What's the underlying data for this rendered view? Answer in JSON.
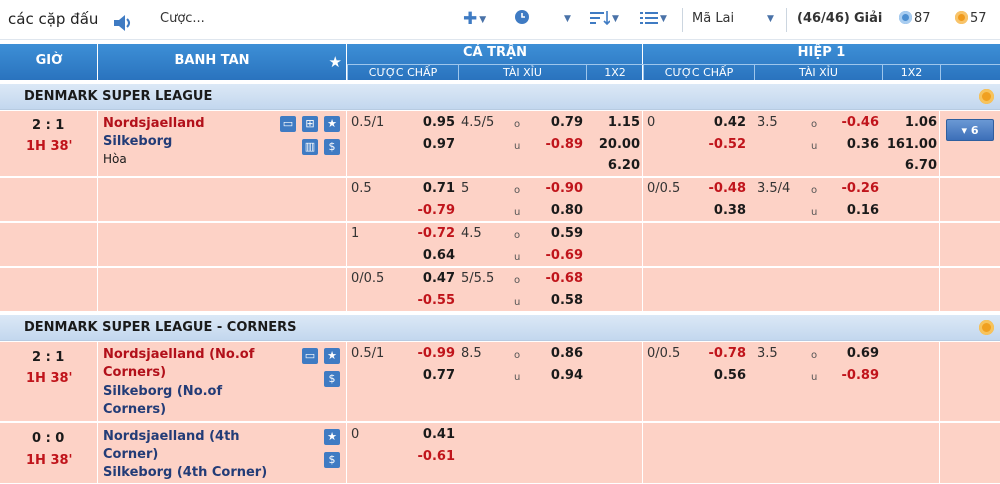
{
  "topbar": {
    "title": "các cặp đấu",
    "bet_label": "Cược...",
    "region": "Mã Lai",
    "league_count": "(46/46)",
    "league_label": "Giải",
    "count1": "87",
    "count2": "57",
    "icons": [
      "speaker-icon",
      "plus-icon",
      "clock-icon",
      "sort-icon",
      "list-icon"
    ]
  },
  "header": {
    "time_col": "GIỜ",
    "match_col": "BANH TAN",
    "full_time": "CẢ TRẬN",
    "first_half": "HIỆP 1",
    "sub": {
      "hdp": "CƯỢC CHẤP",
      "ou": "TÀI XỈU",
      "x12": "1X2"
    }
  },
  "leagues": [
    {
      "name": "DENMARK SUPER LEAGUE",
      "matches": [
        {
          "score": "2 : 1",
          "time": "1H 38'",
          "home": "Nordsjaelland",
          "away": "Silkeborg",
          "draw": "Hòa",
          "more": "▾ 6",
          "lines": [
            {
              "ft_hdp": "0.5/1",
              "ft_hdp_h": "0.95",
              "ft_hdp_a": "0.97",
              "ft_ou": "4.5/5",
              "ft_o": "0.79",
              "ft_u": "-0.89",
              "ft_1": "1.15",
              "ft_2": "20.00",
              "ft_x": "6.20",
              "h1_hdp": "0",
              "h1_hdp_h": "0.42",
              "h1_hdp_a": "-0.52",
              "h1_ou": "3.5",
              "h1_o": "-0.46",
              "h1_u": "0.36",
              "h1_1": "1.06",
              "h1_2": "161.00",
              "h1_x": "6.70"
            },
            {
              "ft_hdp": "0.5",
              "ft_hdp_h": "0.71",
              "ft_hdp_a": "-0.79",
              "ft_ou": "5",
              "ft_o": "-0.90",
              "ft_u": "0.80",
              "h1_hdp": "0/0.5",
              "h1_hdp_h": "-0.48",
              "h1_hdp_a": "0.38",
              "h1_ou": "3.5/4",
              "h1_o": "-0.26",
              "h1_u": "0.16"
            },
            {
              "ft_hdp": "1",
              "ft_hdp_h": "-0.72",
              "ft_hdp_a": "0.64",
              "ft_ou": "4.5",
              "ft_o": "0.59",
              "ft_u": "-0.69"
            },
            {
              "ft_hdp": "0/0.5",
              "ft_hdp_h": "0.47",
              "ft_hdp_a": "-0.55",
              "ft_ou": "5/5.5",
              "ft_o": "-0.68",
              "ft_u": "0.58"
            }
          ]
        }
      ]
    },
    {
      "name": "DENMARK SUPER LEAGUE - CORNERS",
      "matches": [
        {
          "score": "2 : 1",
          "time": "1H 38'",
          "home": "Nordsjaelland (No.of Corners)",
          "home1": "Nordsjaelland (No.of",
          "home2": "Corners)",
          "away1": "Silkeborg (No.of",
          "away2": "Corners)",
          "lines": [
            {
              "ft_hdp": "0.5/1",
              "ft_hdp_h": "-0.99",
              "ft_hdp_a": "0.77",
              "ft_ou": "8.5",
              "ft_o": "0.86",
              "ft_u": "0.94",
              "h1_hdp": "0/0.5",
              "h1_hdp_h": "-0.78",
              "h1_hdp_a": "0.56",
              "h1_ou": "3.5",
              "h1_o": "0.69",
              "h1_u": "-0.89"
            }
          ]
        },
        {
          "score": "0 : 0",
          "time": "1H 38'",
          "home1": "Nordsjaelland (4th",
          "home2": "Corner)",
          "away1": "Silkeborg (4th Corner)",
          "lines": [
            {
              "ft_hdp": "0",
              "ft_hdp_h": "0.41",
              "ft_hdp_a": "-0.61"
            }
          ]
        }
      ]
    }
  ],
  "ou_labels": {
    "o": "o",
    "u": "u"
  }
}
